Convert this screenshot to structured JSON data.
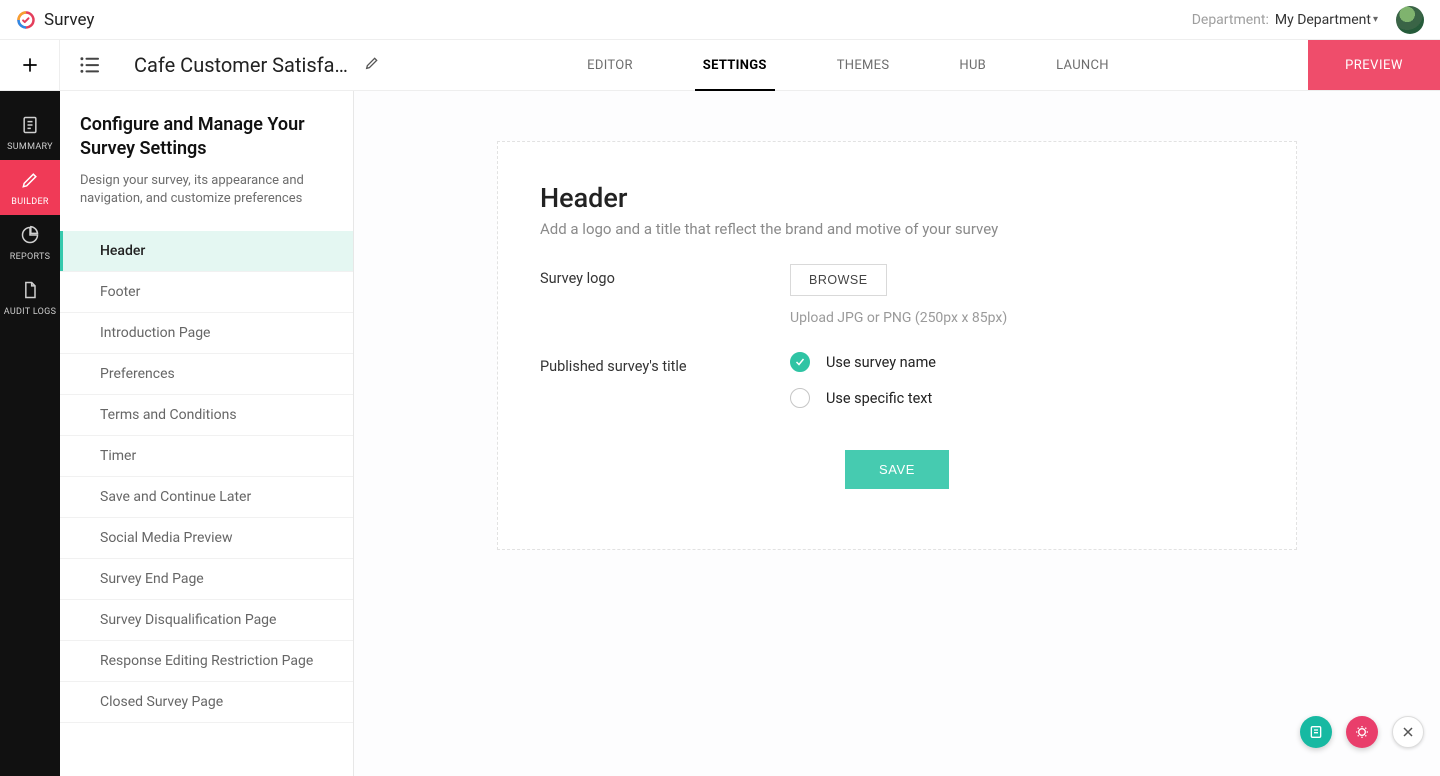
{
  "brand": {
    "app_name": "Survey",
    "dept_label": "Department:",
    "dept_value": "My Department"
  },
  "toolbar": {
    "survey_title": "Cafe Customer Satisfacti...",
    "nav": [
      "EDITOR",
      "SETTINGS",
      "THEMES",
      "HUB",
      "LAUNCH"
    ],
    "active_nav": "SETTINGS",
    "preview_label": "PREVIEW"
  },
  "rail": {
    "items": [
      {
        "label": "SUMMARY",
        "icon": "doc"
      },
      {
        "label": "BUILDER",
        "icon": "pencil"
      },
      {
        "label": "REPORTS",
        "icon": "pie"
      },
      {
        "label": "AUDIT LOGS",
        "icon": "file"
      }
    ],
    "active": "BUILDER"
  },
  "settings_side": {
    "title": "Configure and Manage Your Survey Settings",
    "desc": "Design your survey, its appearance and navigation, and customize preferences",
    "items": [
      "Header",
      "Footer",
      "Introduction Page",
      "Preferences",
      "Terms and Conditions",
      "Timer",
      "Save and Continue Later",
      "Social Media Preview",
      "Survey End Page",
      "Survey Disqualification Page",
      "Response Editing Restriction Page",
      "Closed Survey Page"
    ],
    "active": "Header"
  },
  "panel": {
    "title": "Header",
    "subtitle": "Add a logo and a title that reflect the brand and motive of your survey",
    "logo_label": "Survey logo",
    "browse_label": "BROWSE",
    "upload_hint": "Upload JPG or PNG (250px x 85px)",
    "title_field_label": "Published survey's title",
    "radios": [
      {
        "label": "Use survey name",
        "checked": true
      },
      {
        "label": "Use specific text",
        "checked": false
      }
    ],
    "save_label": "SAVE"
  }
}
